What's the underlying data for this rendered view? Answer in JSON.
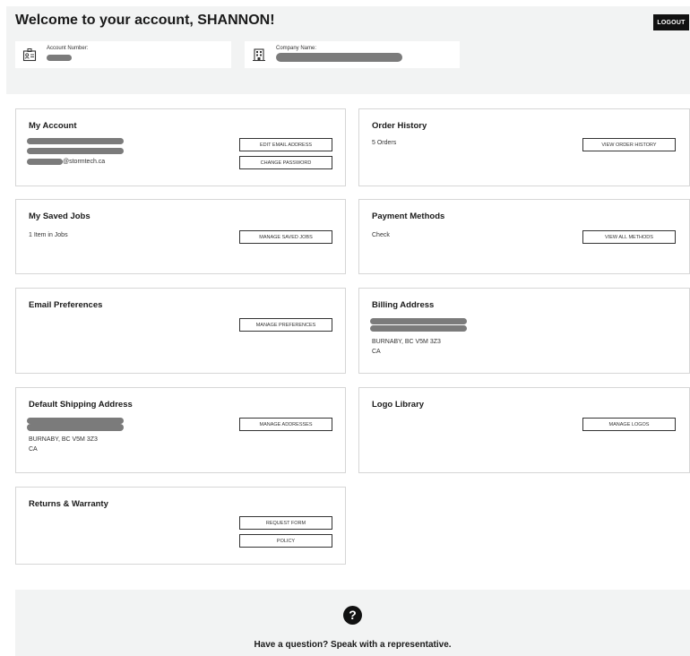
{
  "header": {
    "welcome": "Welcome to your account, SHANNON!",
    "logout_label": "LOGOUT",
    "account_number_label": "Account Number:",
    "company_name_label": "Company Name:"
  },
  "cards": {
    "my_account": {
      "title": "My Account",
      "email_suffix": "@stormtech.ca",
      "edit_email": "EDIT EMAIL ADDRESS",
      "change_password": "CHANGE PASSWORD"
    },
    "order_history": {
      "title": "Order History",
      "count": "5 Orders",
      "button": "VIEW ORDER HISTORY"
    },
    "saved_jobs": {
      "title": "My Saved Jobs",
      "count": "1 Item in Jobs",
      "button": "MANAGE SAVED JOBS"
    },
    "payment_methods": {
      "title": "Payment Methods",
      "method": "Check",
      "button": "VIEW ALL METHODS"
    },
    "email_prefs": {
      "title": "Email Preferences",
      "button": "MANAGE PREFERENCES"
    },
    "billing_address": {
      "title": "Billing Address",
      "city_line": "BURNABY, BC V5M 3Z3",
      "country": "CA"
    },
    "shipping_address": {
      "title": "Default Shipping Address",
      "city_line": "BURNABY, BC V5M 3Z3",
      "country": "CA",
      "button": "MANAGE ADDRESSES"
    },
    "logo_library": {
      "title": "Logo Library",
      "button": "MANAGE LOGOS"
    },
    "returns": {
      "title": "Returns & Warranty",
      "request_form": "REQUEST FORM",
      "policy": "POLICY"
    }
  },
  "footer": {
    "question_icon": "?",
    "text": "Have a question? Speak with a representative."
  },
  "colors": {
    "band": "#f2f3f3",
    "redaction": "#7b7b7b",
    "logout_bg": "#111111"
  }
}
